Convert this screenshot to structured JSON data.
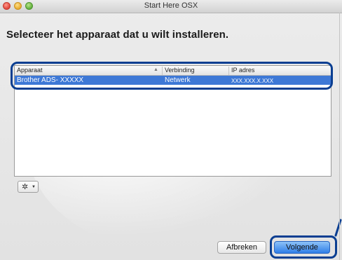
{
  "window": {
    "title": "Start Here OSX"
  },
  "heading": "Selecteer het apparaat dat u wilt installeren.",
  "table": {
    "columns": [
      "Apparaat",
      "Verbinding",
      "IP adres"
    ],
    "rows": [
      {
        "device": "Brother ADS- XXXXX",
        "connection": "Netwerk",
        "ip": "XXX.XXX.X.XXX",
        "selected": true
      }
    ]
  },
  "buttons": {
    "cancel": "Afbreken",
    "next": "Volgende"
  },
  "icons": {
    "action_menu": "gear-icon",
    "dropdown": "chevron-down-icon"
  },
  "colors": {
    "selection": "#3d78d6",
    "highlight_outline": "#0a3e91",
    "default_button": "#2f7ee8"
  }
}
